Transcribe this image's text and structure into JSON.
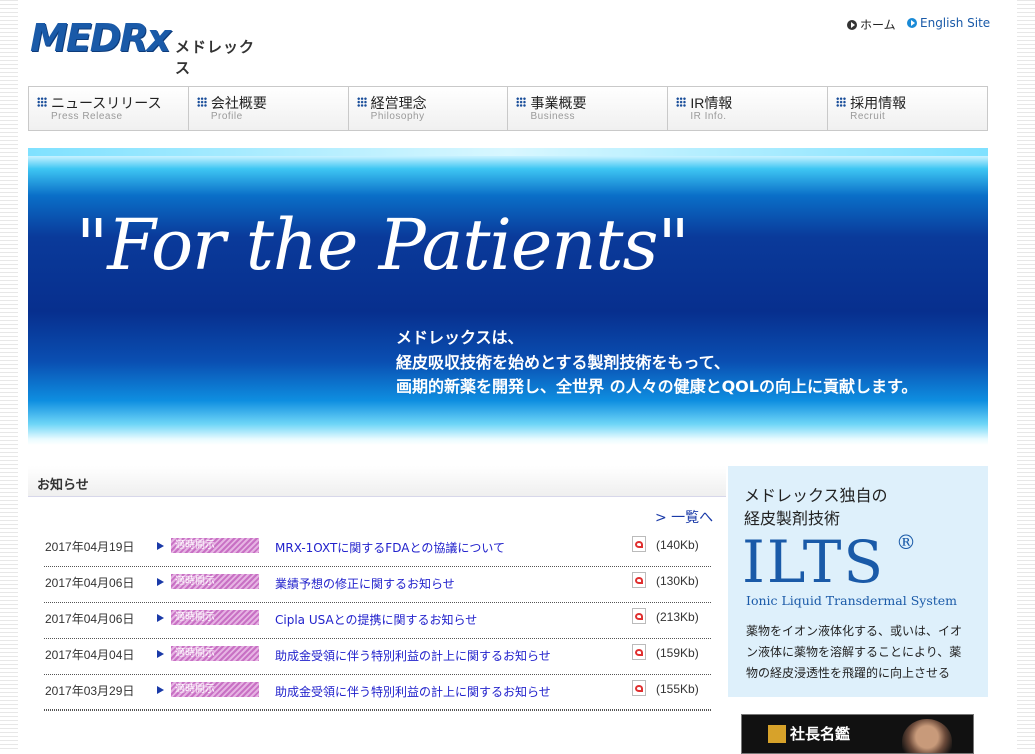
{
  "header": {
    "logo_text": "MEDRx",
    "logo_kana": "メドレックス",
    "home_link": "ホーム",
    "english_link": "English Site"
  },
  "nav": [
    {
      "jp": "ニュースリリース",
      "en": "Press Release"
    },
    {
      "jp": "会社概要",
      "en": "Profile"
    },
    {
      "jp": "経営理念",
      "en": "Philosophy"
    },
    {
      "jp": "事業概要",
      "en": "Business"
    },
    {
      "jp": "IR情報",
      "en": "IR Info."
    },
    {
      "jp": "採用情報",
      "en": "Recruit"
    }
  ],
  "hero": {
    "title": "\"For the Patients\"",
    "line1": "メドレックスは、",
    "line2": "経皮吸収技術を始めとする製剤技術をもって、",
    "line3": "画期的新薬を開発し、全世界 の人々の健康とQOLの向上に貢献します。"
  },
  "news": {
    "title": "お知らせ",
    "list_link": "> 一覧へ",
    "items": [
      {
        "date": "2017年04月19日",
        "badge": "適時開示",
        "title": "MRX-1OXTに関するFDAとの協議について",
        "size": "(140Kb)"
      },
      {
        "date": "2017年04月06日",
        "badge": "適時開示",
        "title": "業績予想の修正に関するお知らせ",
        "size": "(130Kb)"
      },
      {
        "date": "2017年04月06日",
        "badge": "適時開示",
        "title": "Cipla USAとの提携に関するお知らせ",
        "size": "(213Kb)"
      },
      {
        "date": "2017年04月04日",
        "badge": "適時開示",
        "title": "助成金受領に伴う特別利益の計上に関するお知らせ",
        "size": "(159Kb)"
      },
      {
        "date": "2017年03月29日",
        "badge": "適時開示",
        "title": "助成金受領に伴う特別利益の計上に関するお知らせ",
        "size": "(155Kb)"
      }
    ]
  },
  "ilts": {
    "head1": "メドレックス独自の",
    "head2": "経皮製剤技術",
    "logo": "ILTS",
    "reg": "®",
    "subtitle": "Ionic Liquid Transdermal System",
    "desc1": "薬物をイオン液体化する、或いは、イオ",
    "desc2": "ン液体に薬物を溶解することにより、薬",
    "desc3": "物の経皮浸透性を飛躍的に向上させる"
  },
  "president_banner": {
    "label": "社長名鑑"
  }
}
